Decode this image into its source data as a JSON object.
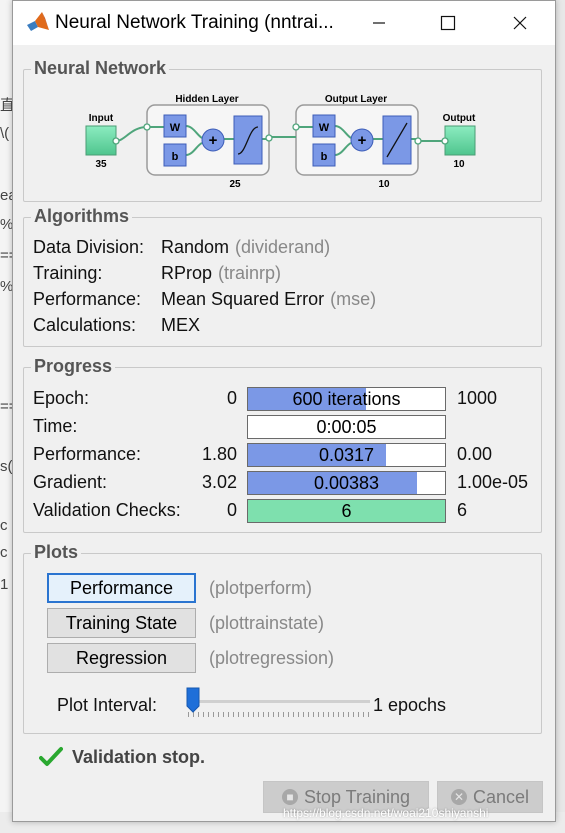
{
  "window": {
    "title": "Neural Network Training (nntrai..."
  },
  "background_glyphs": [
    "直",
    "\\(",
    "ea",
    "%/",
    "==",
    "%/",
    "==",
    "s(",
    "c ",
    "c ",
    "1"
  ],
  "network": {
    "section_title": "Neural Network",
    "input_label": "Input",
    "input_size": "35",
    "hidden_label": "Hidden Layer",
    "hidden_size": "25",
    "output_layer_label": "Output Layer",
    "output_layer_size": "10",
    "output_label": "Output",
    "output_size": "10",
    "weight_symbol": "W",
    "bias_symbol": "b",
    "sum_symbol": "+"
  },
  "algorithms": {
    "section_title": "Algorithms",
    "rows": [
      {
        "label": "Data Division:",
        "value": "Random",
        "fn": "(dividerand)"
      },
      {
        "label": "Training:",
        "value": "RProp",
        "fn": "(trainrp)"
      },
      {
        "label": "Performance:",
        "value": "Mean Squared Error",
        "fn": "(mse)"
      },
      {
        "label": "Calculations:",
        "value": "MEX",
        "fn": ""
      }
    ]
  },
  "progress": {
    "section_title": "Progress",
    "rows": [
      {
        "label": "Epoch:",
        "min": "0",
        "value": "600 iterations",
        "max": "1000",
        "fill_fraction": 0.6,
        "fill_color": "#7b98e6"
      },
      {
        "label": "Time:",
        "min": "",
        "value": "0:00:05",
        "max": "",
        "fill_fraction": 0,
        "fill_color": "#7b98e6"
      },
      {
        "label": "Performance:",
        "min": "1.80",
        "value": "0.0317",
        "max": "0.00",
        "fill_fraction": 0.7,
        "fill_color": "#7b98e6"
      },
      {
        "label": "Gradient:",
        "min": "3.02",
        "value": "0.00383",
        "max": "1.00e-05",
        "fill_fraction": 0.86,
        "fill_color": "#7b98e6"
      },
      {
        "label": "Validation Checks:",
        "min": "0",
        "value": "6",
        "max": "6",
        "fill_fraction": 1.0,
        "fill_color": "#7ee0ae"
      }
    ]
  },
  "plots": {
    "section_title": "Plots",
    "buttons": [
      {
        "label": "Performance",
        "fn": "(plotperform)"
      },
      {
        "label": "Training State",
        "fn": "(plottrainstate)"
      },
      {
        "label": "Regression",
        "fn": "(plotregression)"
      }
    ],
    "interval_label": "Plot Interval:",
    "interval_value": "1 epochs"
  },
  "status": {
    "message": "Validation stop."
  },
  "actions": {
    "stop_label": "Stop Training",
    "cancel_label": "Cancel"
  },
  "watermark": "https://blog.csdn.net/woai210shiyanshi",
  "colors": {
    "bar_fill": "#7b98e6",
    "validation_fill": "#7ee0ae",
    "layer_box": "#7b98e6",
    "io_box": "#7ee0ae",
    "focus_border": "#2a74d0",
    "check_green": "#2aa830"
  }
}
